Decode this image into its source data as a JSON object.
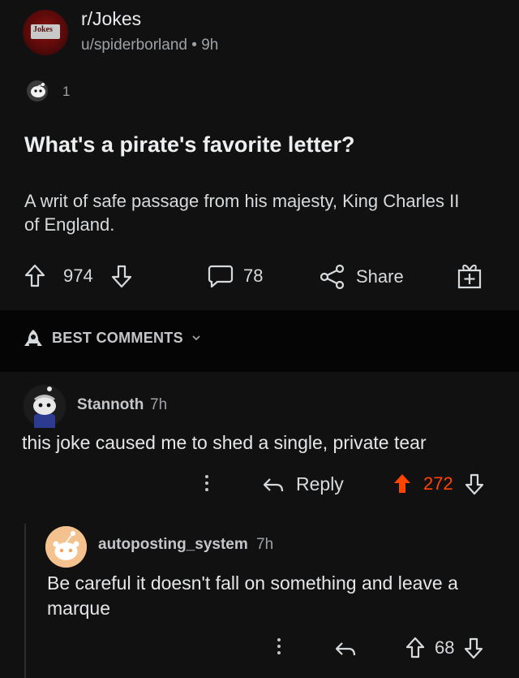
{
  "post": {
    "subreddit": "r/Jokes",
    "avatar_text": "Jokes",
    "author": "u/spiderborland",
    "separator": "•",
    "age": "9h",
    "award_count": "1",
    "title": "What's a pirate's favorite letter?",
    "body": "A writ of safe passage from his majesty, King Charles II of England.",
    "upvotes": "974",
    "comment_count": "78",
    "share_label": "Share"
  },
  "sort": {
    "label": "BEST COMMENTS"
  },
  "comments": [
    {
      "author": "Stannoth",
      "age": "7h",
      "text": "this joke caused me to shed a single, private tear",
      "reply_label": "Reply",
      "votes": "272",
      "upvoted": true
    },
    {
      "author": "autoposting_system",
      "age": "7h",
      "text": "Be careful it doesn't fall on something and leave a marque",
      "votes": "68"
    }
  ],
  "colors": {
    "background": "#111112",
    "upvote_active": "#ff4500",
    "text": "#d7dadc",
    "muted": "#9ea2a6"
  }
}
